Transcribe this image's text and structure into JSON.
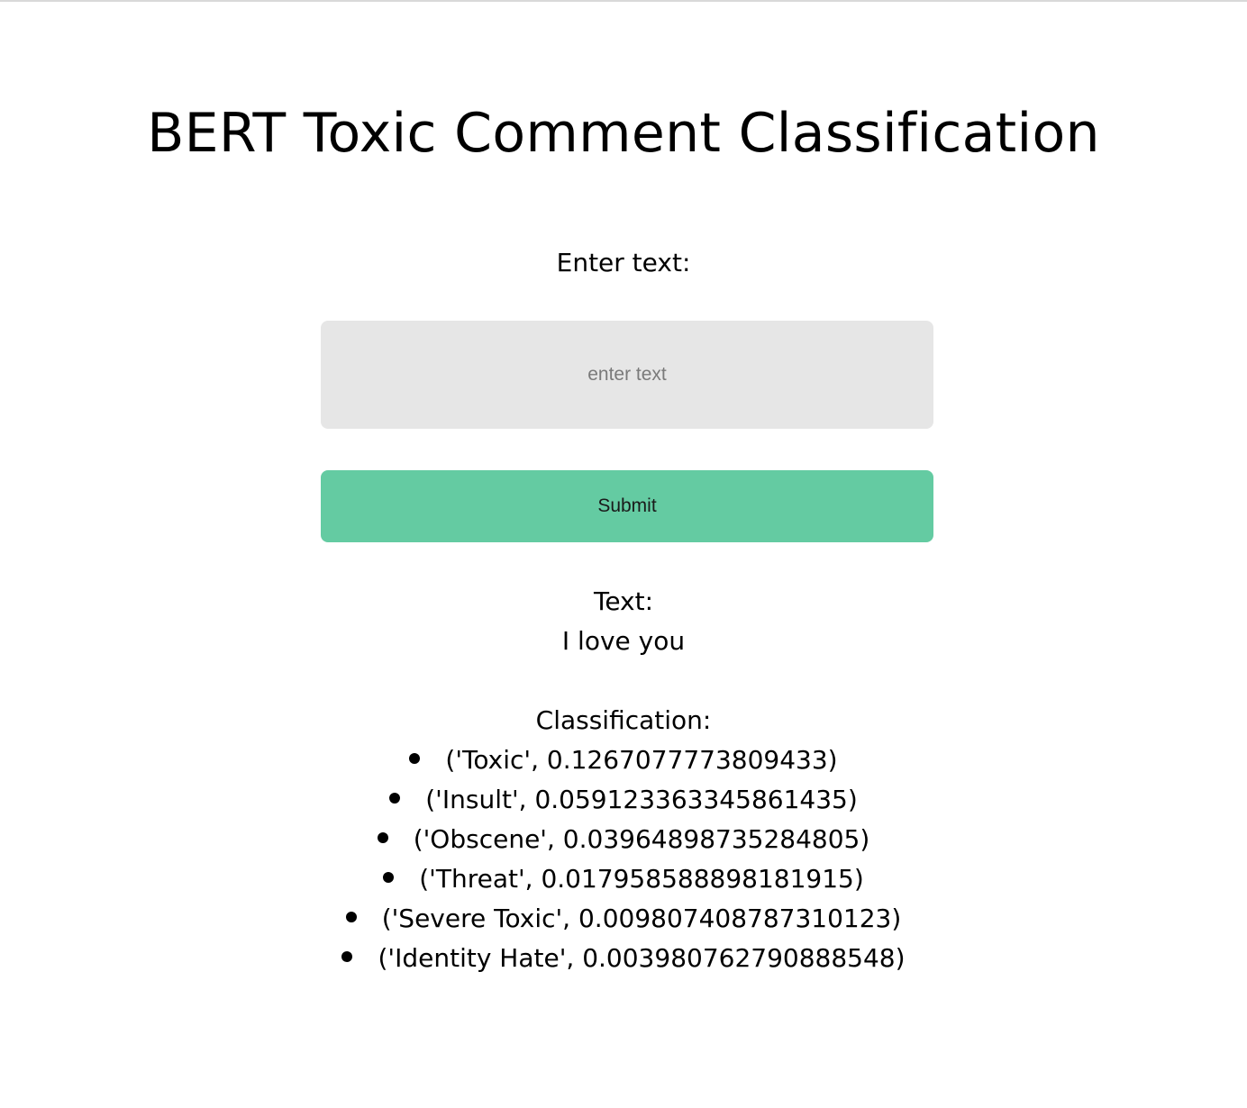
{
  "page": {
    "title": "BERT Toxic Comment Classification"
  },
  "form": {
    "label": "Enter text:",
    "placeholder": "enter text",
    "value": "",
    "submit_label": "Submit"
  },
  "result": {
    "text_label": "Text:",
    "text_value": "I love you",
    "classification_label": "Classification:",
    "items": [
      "('Toxic', 0.1267077773809433)",
      "('Insult', 0.059123363345861435)",
      "('Obscene', 0.03964898735284805)",
      "('Threat', 0.017958588898181915)",
      "('Severe Toxic', 0.009807408787310123)",
      "('Identity Hate', 0.003980762790888548)"
    ]
  }
}
